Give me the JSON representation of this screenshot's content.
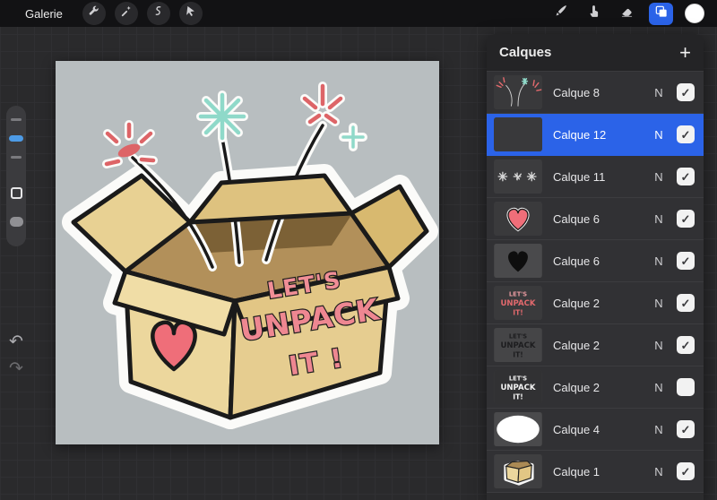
{
  "topbar": {
    "gallery_label": "Galerie",
    "left_tools": [
      {
        "name": "actions",
        "icon": "wrench-icon"
      },
      {
        "name": "adjustments",
        "icon": "magic-wand-icon"
      },
      {
        "name": "selection",
        "icon": "selection-s-icon"
      },
      {
        "name": "transform",
        "icon": "transform-arrow-icon"
      }
    ],
    "right_tools": [
      {
        "name": "paint",
        "icon": "brush-icon",
        "active": false
      },
      {
        "name": "smudge",
        "icon": "smudge-icon",
        "active": false
      },
      {
        "name": "erase",
        "icon": "eraser-icon",
        "active": false
      },
      {
        "name": "layers",
        "icon": "layers-icon",
        "active": true
      },
      {
        "name": "color",
        "icon": "color-disc",
        "color": "#ffffff"
      }
    ]
  },
  "sidebar": {
    "undo_glyph": "↶",
    "redo_glyph": "↷"
  },
  "layers_panel": {
    "title": "Calques",
    "add_label": "+",
    "rows": [
      {
        "name": "Calque 8",
        "blend": "N",
        "check": "✓",
        "selected": false,
        "thumb": "fireworks"
      },
      {
        "name": "Calque 12",
        "blend": "N",
        "check": "✓",
        "selected": true,
        "thumb": "plain-dark"
      },
      {
        "name": "Calque 11",
        "blend": "N",
        "check": "✓",
        "selected": false,
        "thumb": "sparks"
      },
      {
        "name": "Calque 6",
        "blend": "N",
        "check": "✓",
        "selected": false,
        "thumb": "heart-pink"
      },
      {
        "name": "Calque 6",
        "blend": "N",
        "check": "✓",
        "selected": false,
        "thumb": "heart-black"
      },
      {
        "name": "Calque 2",
        "blend": "N",
        "check": "✓",
        "selected": false,
        "thumb": "text-pink"
      },
      {
        "name": "Calque 2",
        "blend": "N",
        "check": "✓",
        "selected": false,
        "thumb": "text-outline"
      },
      {
        "name": "Calque 2",
        "blend": "N",
        "check": "",
        "selected": false,
        "thumb": "text-white"
      },
      {
        "name": "Calque 4",
        "blend": "N",
        "check": "✓",
        "selected": false,
        "thumb": "white-ellipse"
      },
      {
        "name": "Calque 1",
        "blend": "N",
        "check": "✓",
        "selected": false,
        "thumb": "box-art"
      }
    ]
  },
  "canvas": {
    "sticker_text": {
      "line1": "LET'S",
      "line2": "UNPACK",
      "line3": "IT !"
    },
    "colors": {
      "canvas_bg": "#b8bec0",
      "box_tan": "#ecd79d",
      "box_side": "#e6cd90",
      "box_interior": "#b2905a",
      "heart": "#ef6e79",
      "text_pink": "#f08e96",
      "spark_red": "#dd6467",
      "spark_teal": "#8fd9c9",
      "sticker_white": "#fbfbf9",
      "selection_blue": "#2b63e8"
    }
  }
}
